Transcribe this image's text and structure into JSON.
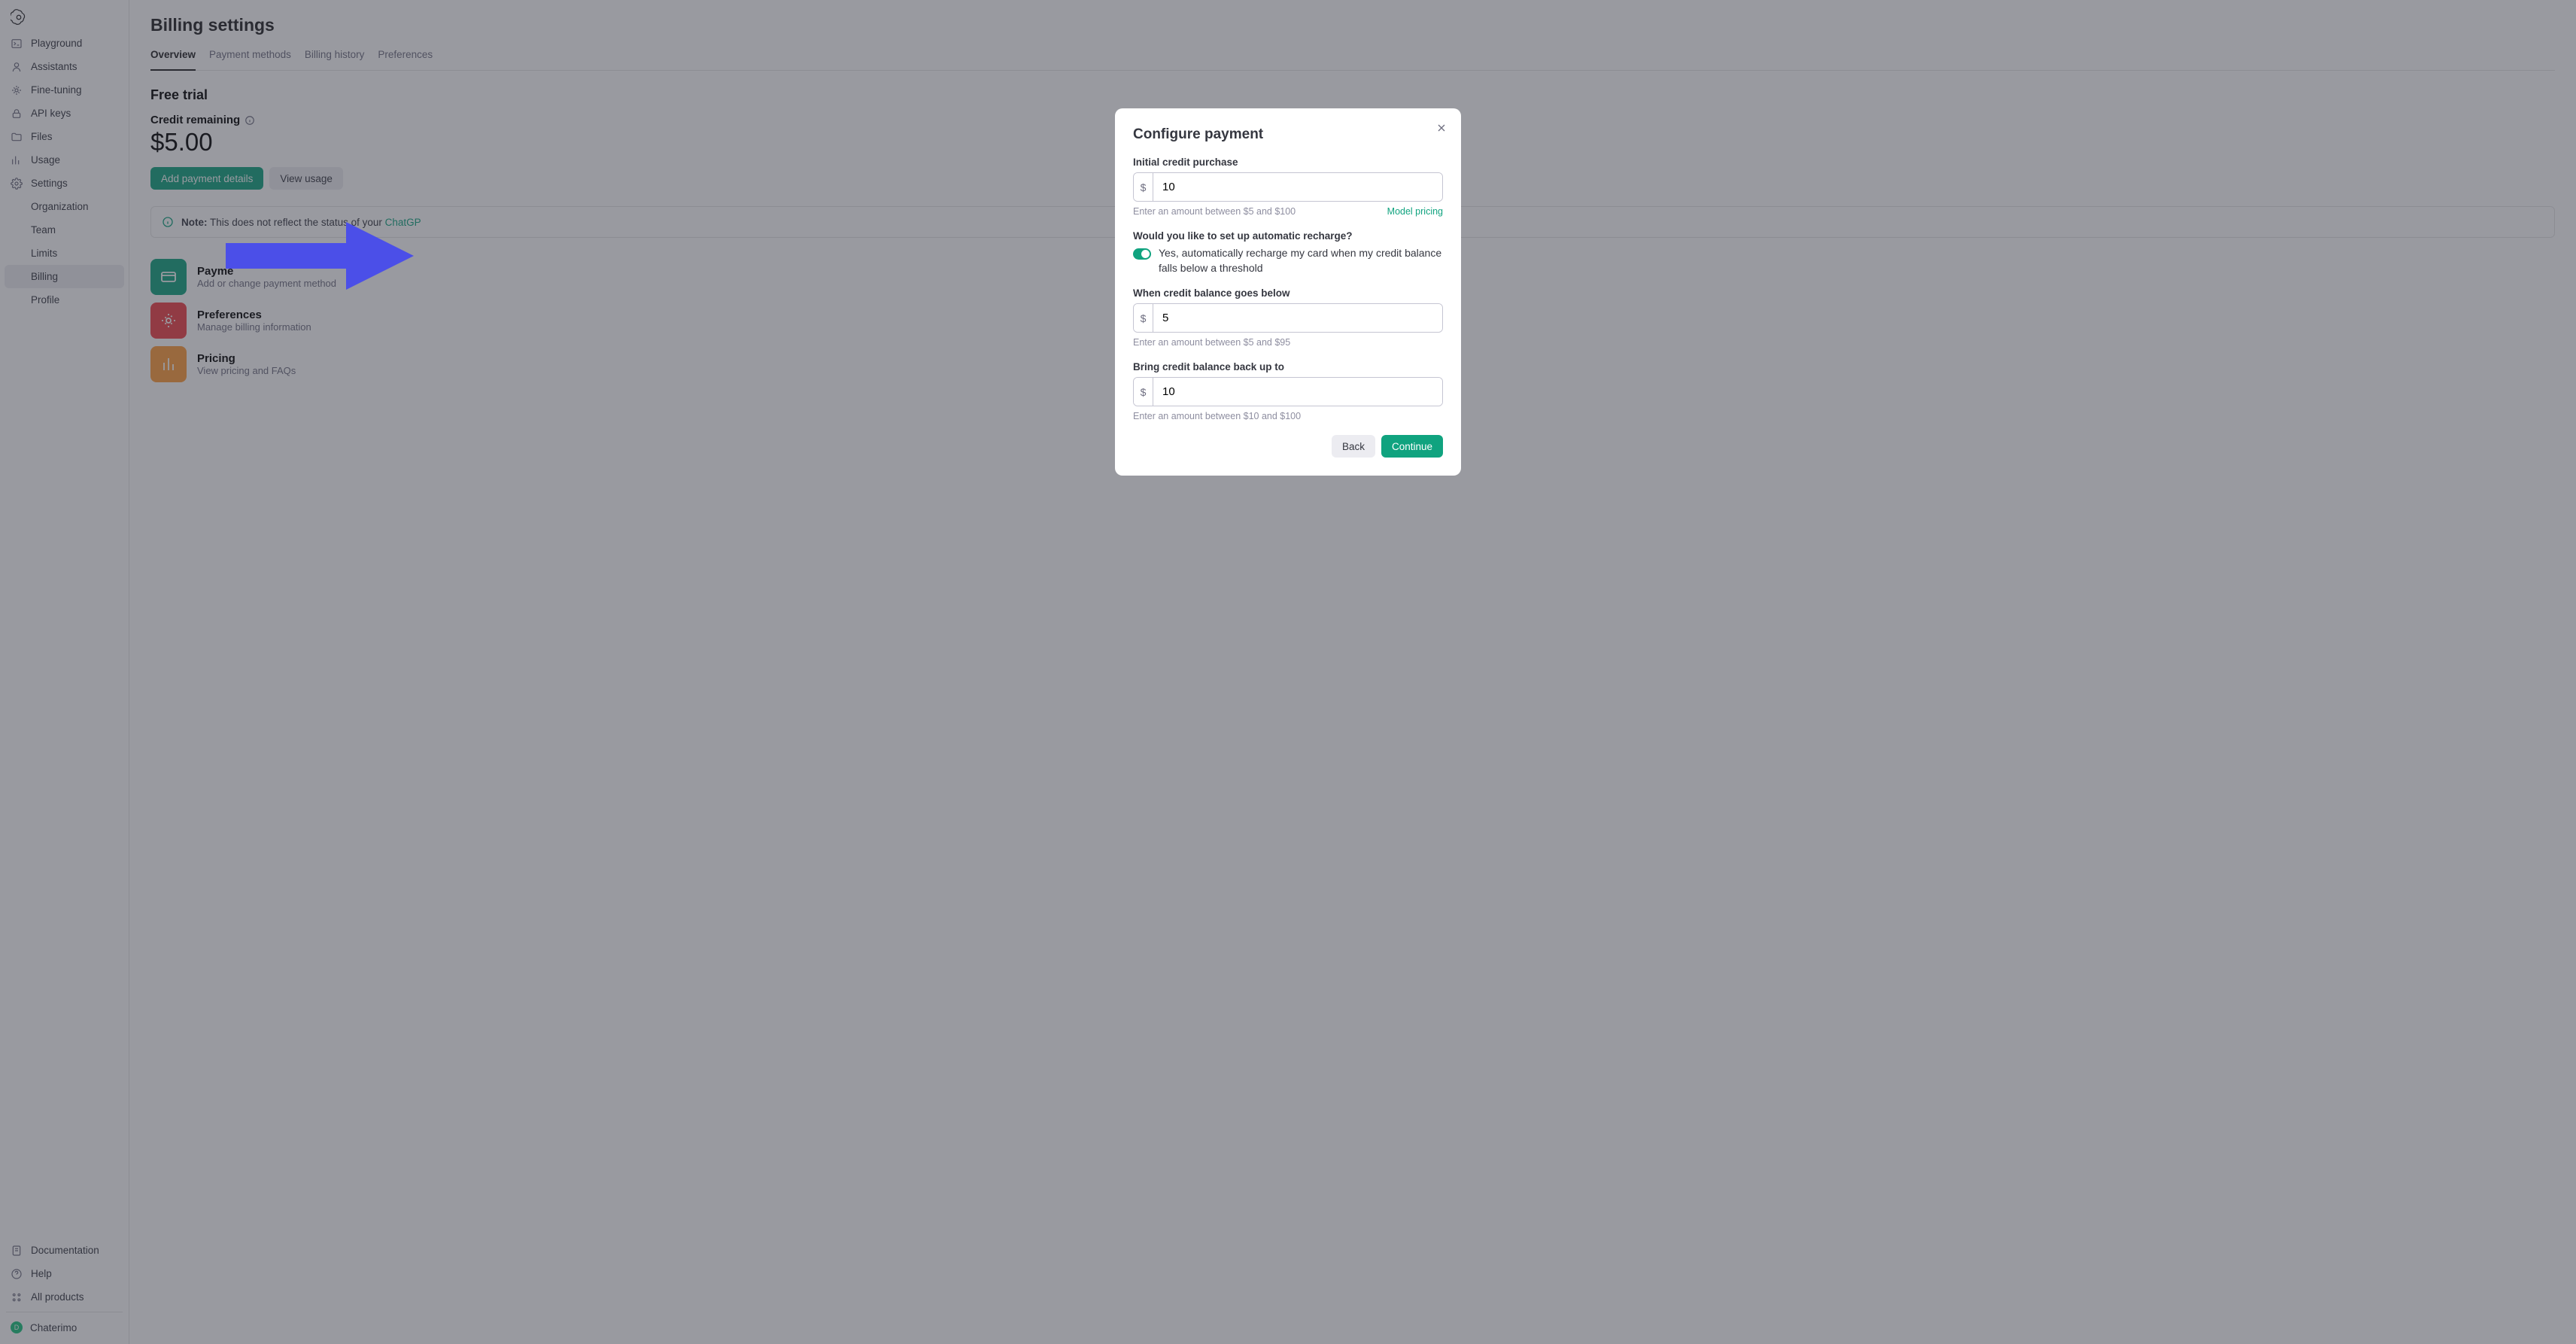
{
  "sidebar": {
    "logo": "openai-logo",
    "items": [
      {
        "icon": "terminal-icon",
        "label": "Playground"
      },
      {
        "icon": "robot-icon",
        "label": "Assistants"
      },
      {
        "icon": "sliders-icon",
        "label": "Fine-tuning"
      },
      {
        "icon": "lock-icon",
        "label": "API keys"
      },
      {
        "icon": "folder-icon",
        "label": "Files"
      },
      {
        "icon": "chart-icon",
        "label": "Usage"
      }
    ],
    "settings": {
      "icon": "gear-icon",
      "label": "Settings",
      "children": [
        {
          "label": "Organization"
        },
        {
          "label": "Team"
        },
        {
          "label": "Limits"
        },
        {
          "label": "Billing",
          "active": true
        },
        {
          "label": "Profile"
        }
      ]
    },
    "footer": [
      {
        "icon": "doc-icon",
        "label": "Documentation"
      },
      {
        "icon": "help-icon",
        "label": "Help"
      },
      {
        "icon": "grid-icon",
        "label": "All products"
      }
    ],
    "user": {
      "initial": "D",
      "name": "Chaterimo"
    }
  },
  "main": {
    "title": "Billing settings",
    "tabs": [
      "Overview",
      "Payment methods",
      "Billing history",
      "Preferences"
    ],
    "active_tab": 0,
    "section_title": "Free trial",
    "credit_label": "Credit remaining",
    "credit_amount": "$5.00",
    "buttons": {
      "add": "Add payment details",
      "usage": "View usage"
    },
    "note": {
      "b": "Note:",
      "text": " This does not reflect the status of your ",
      "link": "ChatGP"
    },
    "cards": [
      {
        "color": "green",
        "title": "Payme",
        "sub": "Add or change payment method"
      },
      {
        "color": "red",
        "title": "Preferences",
        "sub": "Manage billing information"
      },
      {
        "color": "orange",
        "title": "Pricing",
        "sub": "View pricing and FAQs"
      }
    ]
  },
  "modal": {
    "title": "Configure payment",
    "initial_label": "Initial credit purchase",
    "initial_value": "10",
    "initial_helper": "Enter an amount between $5 and $100",
    "model_pricing": "Model pricing",
    "auto_label": "Would you like to set up automatic recharge?",
    "toggle_text": "Yes, automatically recharge my card when my credit balance falls below a threshold",
    "below_label": "When credit balance goes below",
    "below_value": "5",
    "below_helper": "Enter an amount between $5 and $95",
    "bring_label": "Bring credit balance back up to",
    "bring_value": "10",
    "bring_helper": "Enter an amount between $10 and $100",
    "back": "Back",
    "continue": "Continue"
  }
}
